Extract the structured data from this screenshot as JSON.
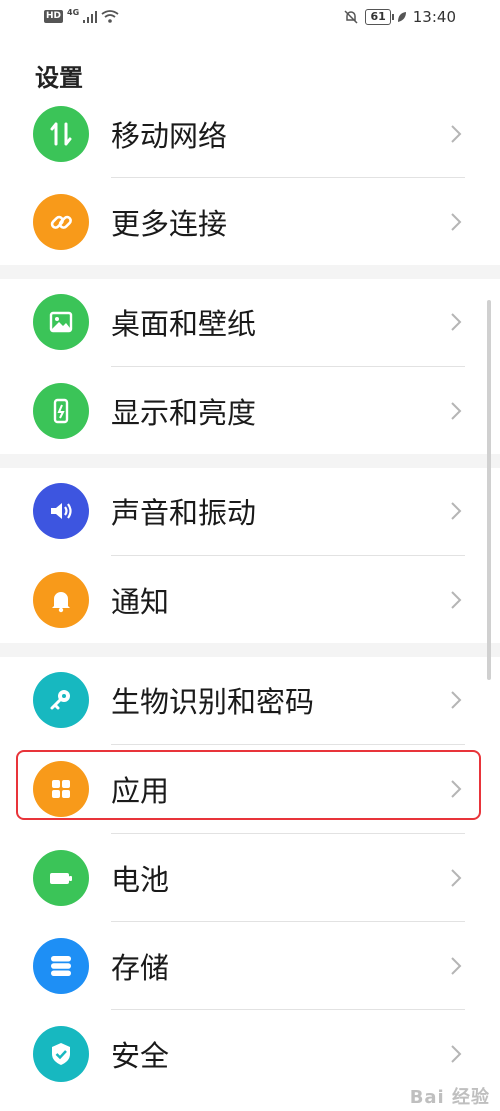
{
  "status_bar": {
    "hd": "HD",
    "network": "4G",
    "battery": "61",
    "time": "13:40"
  },
  "page_title": "设置",
  "items": [
    {
      "label": "移动网络",
      "icon": "mobile-data-icon",
      "color": "#3bc458"
    },
    {
      "label": "更多连接",
      "icon": "link-icon",
      "color": "#f89a1a"
    },
    {
      "label": "桌面和壁纸",
      "icon": "wallpaper-icon",
      "color": "#3bc458"
    },
    {
      "label": "显示和亮度",
      "icon": "display-brightness-icon",
      "color": "#3bc458"
    },
    {
      "label": "声音和振动",
      "icon": "sound-icon",
      "color": "#3d55e0"
    },
    {
      "label": "通知",
      "icon": "bell-icon",
      "color": "#f89a1a"
    },
    {
      "label": "生物识别和密码",
      "icon": "key-icon",
      "color": "#17b8c0"
    },
    {
      "label": "应用",
      "icon": "apps-grid-icon",
      "color": "#f89a1a"
    },
    {
      "label": "电池",
      "icon": "battery-icon",
      "color": "#3bc458"
    },
    {
      "label": "存储",
      "icon": "storage-icon",
      "color": "#1e8ff5"
    },
    {
      "label": "安全",
      "icon": "shield-check-icon",
      "color": "#17b8c0"
    }
  ],
  "watermark": "Bai 经验"
}
